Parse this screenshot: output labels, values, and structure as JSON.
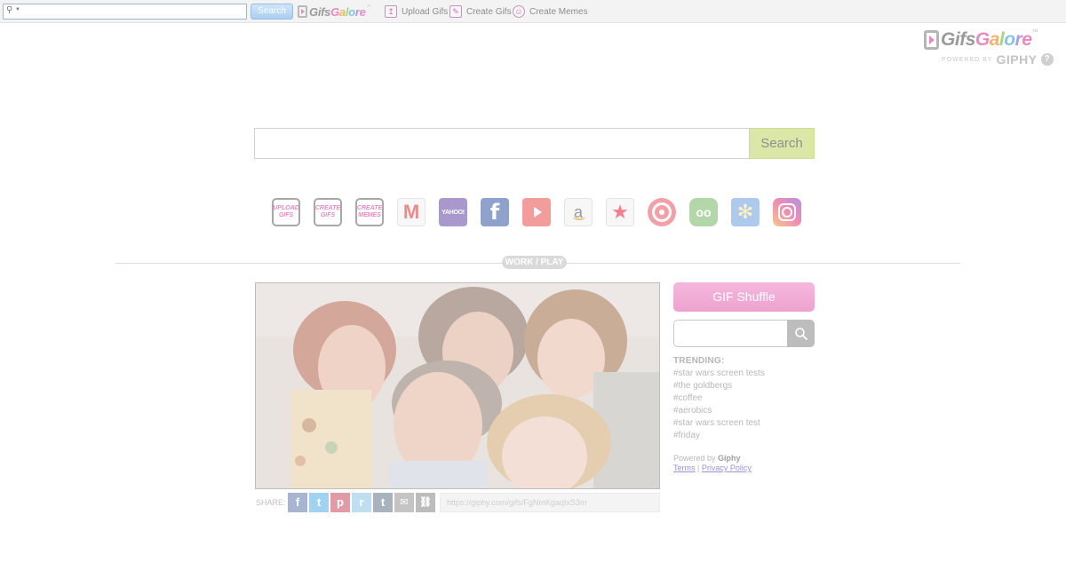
{
  "toolbar": {
    "search_value": "",
    "search_button": "Search",
    "logo_text": "GifsGalore",
    "logo_tm": "™",
    "links": [
      {
        "label": "Upload Gifs",
        "icon": "upload-icon"
      },
      {
        "label": "Create Gifs",
        "icon": "pencil-icon"
      },
      {
        "label": "Create Memes",
        "icon": "smiley-icon"
      }
    ]
  },
  "corner_logo": {
    "word": "GifsGalore",
    "tm": "™",
    "powered_by": "POWERED BY",
    "giphy": "GIPHY",
    "help": "?"
  },
  "main_search": {
    "value": "",
    "button": "Search"
  },
  "quick_links": [
    {
      "id": "upload-gifs",
      "label": "UPLOAD GIFS",
      "icon": "upload-gifs-badge"
    },
    {
      "id": "create-gifs",
      "label": "CREATE GIFS",
      "icon": "create-gifs-badge"
    },
    {
      "id": "create-memes",
      "label": "CREATE MEMES",
      "icon": "create-memes-badge"
    },
    {
      "id": "gmail",
      "label": "M",
      "icon": "gmail-icon"
    },
    {
      "id": "yahoo",
      "label": "YAHOO!",
      "icon": "yahoo-icon"
    },
    {
      "id": "facebook",
      "label": "f",
      "icon": "facebook-icon"
    },
    {
      "id": "youtube",
      "label": "",
      "icon": "youtube-icon"
    },
    {
      "id": "amazon",
      "label": "a",
      "icon": "amazon-icon"
    },
    {
      "id": "macys",
      "label": "★",
      "icon": "macys-star-icon"
    },
    {
      "id": "target",
      "label": "",
      "icon": "target-icon"
    },
    {
      "id": "tripadvisor",
      "label": "oo",
      "icon": "tripadvisor-icon"
    },
    {
      "id": "walmart",
      "label": "✻",
      "icon": "walmart-spark-icon"
    },
    {
      "id": "instagram",
      "label": "",
      "icon": "instagram-icon"
    }
  ],
  "section_label": "WORK / PLAY",
  "share": {
    "label": "SHARE:",
    "buttons": [
      {
        "label": "f",
        "icon": "facebook-icon"
      },
      {
        "label": "t",
        "icon": "twitter-icon"
      },
      {
        "label": "p",
        "icon": "pinterest-icon"
      },
      {
        "label": "r",
        "icon": "reddit-icon"
      },
      {
        "label": "t",
        "icon": "tumblr-icon"
      },
      {
        "label": "✉",
        "icon": "email-icon"
      },
      {
        "label": "⛓",
        "icon": "link-icon"
      }
    ],
    "url": "https://giphy.com/gifs/FgNmKgaqIxS3m"
  },
  "sidebar": {
    "shuffle": "GIF Shuffle",
    "search_value": "",
    "trending_title": "TRENDING:",
    "trending": [
      "#star wars screen tests",
      "#the goldbergs",
      "#coffee",
      "#aerobics",
      "#star wars screen test",
      "#friday"
    ],
    "powered_prefix": "Powered by",
    "powered_brand": "Giphy",
    "terms": "Terms",
    "separator": "|",
    "privacy": "Privacy Policy"
  },
  "colors": {
    "accent_pink": "#eea2cf",
    "search_green": "#dbe7a6",
    "link_purple": "#9c93d8"
  }
}
